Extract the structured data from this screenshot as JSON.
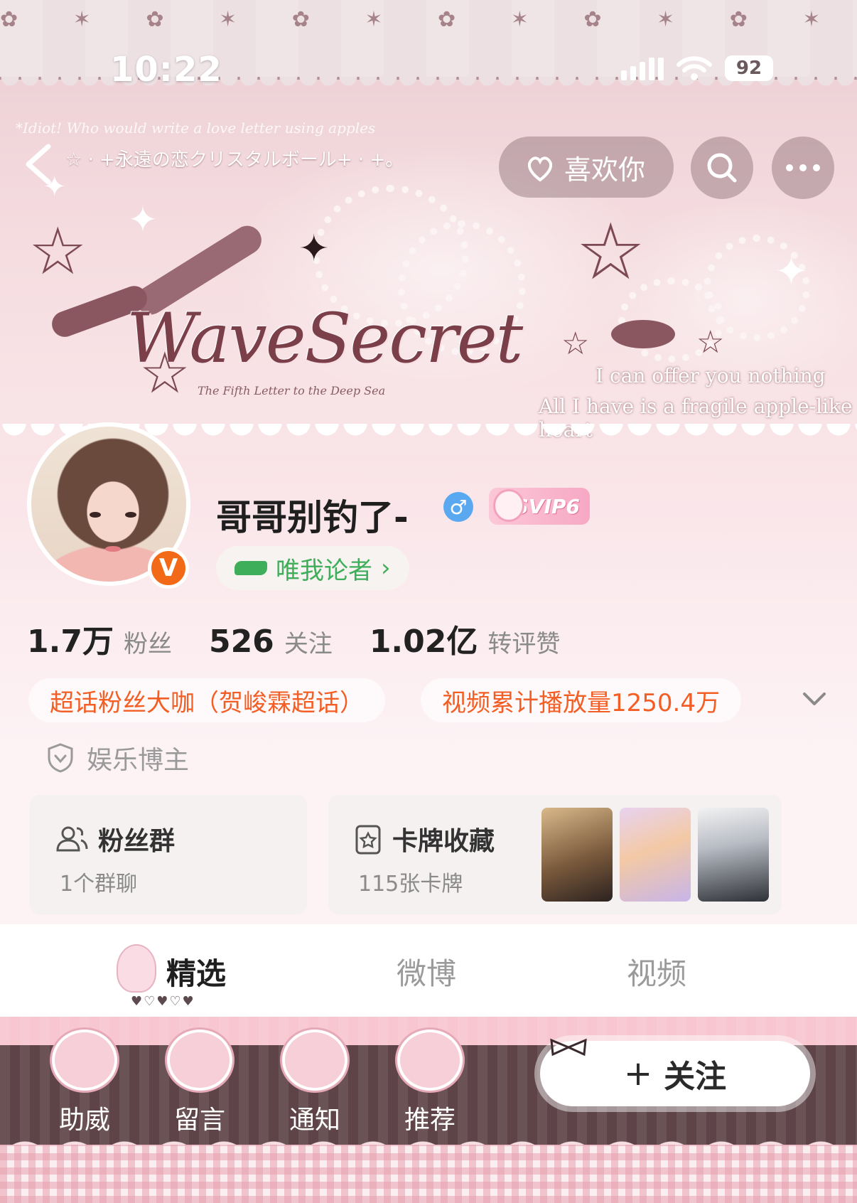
{
  "status_bar": {
    "time": "10:22",
    "battery": "92"
  },
  "banner": {
    "caption_top": "*Idiot! Who would write a love letter using apples",
    "subtitle": "☆ · +永遠の恋クリスタルボール+ · +。",
    "logo": "WaveSecret",
    "logo_sub": "The Fifth Letter to the Deep Sea",
    "quote_line1": "I can offer you nothing",
    "quote_line2": "All I have is a fragile apple-like heart",
    "like_button": "喜欢你"
  },
  "profile": {
    "username": "哥哥别钓了-",
    "gender_symbol": "♂",
    "vip_badge": "SVIP6",
    "verified_badge": "V",
    "fan_club": "唯我论者",
    "fan_club_chevron": "›",
    "stats": [
      {
        "value": "1.7万",
        "label": "粉丝"
      },
      {
        "value": "526",
        "label": "关注"
      },
      {
        "value": "1.02亿",
        "label": "转评赞"
      }
    ],
    "tags": [
      "超话粉丝大咖（贺峻霖超话）",
      "视频累计播放量1250.4万"
    ],
    "category": "娱乐博主"
  },
  "cards": {
    "fan_group": {
      "title": "粉丝群",
      "sub": "1个群聊"
    },
    "card_collection": {
      "title": "卡牌收藏",
      "sub": "115张卡牌"
    }
  },
  "tabs": [
    "精选",
    "微博",
    "视频"
  ],
  "tab_hearts": "♥♡♥♡♥",
  "bottom_nav": [
    "助威",
    "留言",
    "通知",
    "推荐"
  ],
  "follow_button": {
    "plus": "+",
    "label": "关注"
  },
  "colors": {
    "accent_orange": "#f35e24",
    "fan_club_green": "#3fae5b",
    "verified_orange": "#f26a17",
    "gender_blue": "#5aa9f0"
  },
  "icons": {
    "back": "chevron-left-icon",
    "search": "search-icon",
    "more": "more-horizontal-icon",
    "expand": "chevron-down-icon",
    "category": "shield-icon",
    "fan_group": "users-icon",
    "card_collection": "card-icon"
  }
}
